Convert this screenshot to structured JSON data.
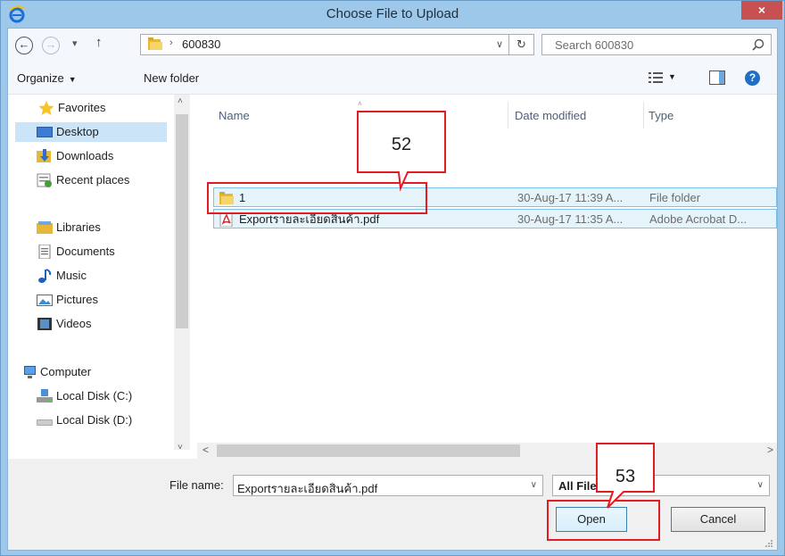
{
  "window": {
    "title": "Choose File to Upload",
    "close_glyph": "×"
  },
  "address": {
    "back_glyph": "←",
    "forward_glyph": "→",
    "recent_glyph": "▾",
    "up_glyph": "↑",
    "path_sep": "›",
    "path": "600830",
    "dropdown_glyph": "∨",
    "refresh_glyph": "↻",
    "search_placeholder": "Search 600830"
  },
  "toolbar": {
    "organize_label": "Organize",
    "caret": "▼",
    "new_folder_label": "New folder",
    "view_caret": "▼",
    "help_glyph": "?"
  },
  "nav": {
    "favorites": "Favorites",
    "desktop": "Desktop",
    "downloads": "Downloads",
    "recent": "Recent places",
    "libraries": "Libraries",
    "documents": "Documents",
    "music": "Music",
    "pictures": "Pictures",
    "videos": "Videos",
    "computer": "Computer",
    "local_c": "Local Disk (C:)",
    "local_d": "Local Disk (D:)",
    "scroll_up": "˄",
    "scroll_down": "˅"
  },
  "columns": {
    "name": "Name",
    "date_modified": "Date modified",
    "type": "Type",
    "sort_caret": "˄"
  },
  "files": [
    {
      "name": "1",
      "date": "30-Aug-17 11:39 A...",
      "type": "File folder",
      "icon": "folder-icon"
    },
    {
      "name": "Exportรายละเอียดสินค้า.pdf",
      "date": "30-Aug-17 11:35 A...",
      "type": "Adobe Acrobat D...",
      "icon": "pdf-icon"
    }
  ],
  "hscroll": {
    "left": "<",
    "right": ">"
  },
  "bottom": {
    "file_name_label": "File name:",
    "file_name_value": "Exportรายละเอียดสินค้า.pdf",
    "file_name_drop": "∨",
    "file_type_value": "All Files",
    "file_type_drop": "∨",
    "open_label": "Open",
    "cancel_label": "Cancel"
  },
  "annotations": {
    "callout_1": "52",
    "callout_2": "53",
    "color": "#e31b23"
  },
  "colors": {
    "titlebar": "#9ec8ea",
    "close": "#c75050",
    "selection": "#cce4f7"
  }
}
